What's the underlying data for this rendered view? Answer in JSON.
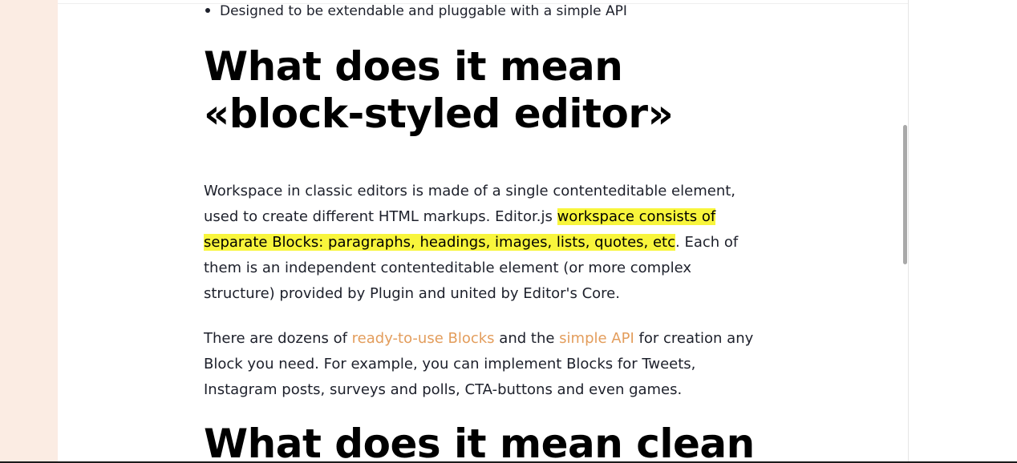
{
  "bullet": {
    "text": "Designed to be extendable and pluggable with a simple API"
  },
  "section1": {
    "heading_line1": "What does it mean",
    "heading_line2": "«block-styled editor»"
  },
  "paragraph1": {
    "before_mark": "Workspace in classic editors is made of a single contenteditable element, used to create different HTML markups. Editor.js ",
    "marked": "workspace consists of separate Blocks: paragraphs, headings, images, lists, quotes, etc",
    "after_mark": ". Each of them is an independent contenteditable element (or more complex structure) provided by Plugin and united by Editor's Core."
  },
  "paragraph2": {
    "text1": "There are dozens of ",
    "link1": "ready-to-use Blocks",
    "text2": " and the ",
    "link2": "simple API",
    "text3": " for creation any Block you need. For example, you can implement Blocks for Tweets, Instagram posts, surveys and polls, CTA-buttons and even games."
  },
  "section2": {
    "heading": "What does it mean clean"
  },
  "colors": {
    "highlight": "#f8f53c",
    "link": "#e39d5c",
    "left_gutter": "#fbece3"
  }
}
